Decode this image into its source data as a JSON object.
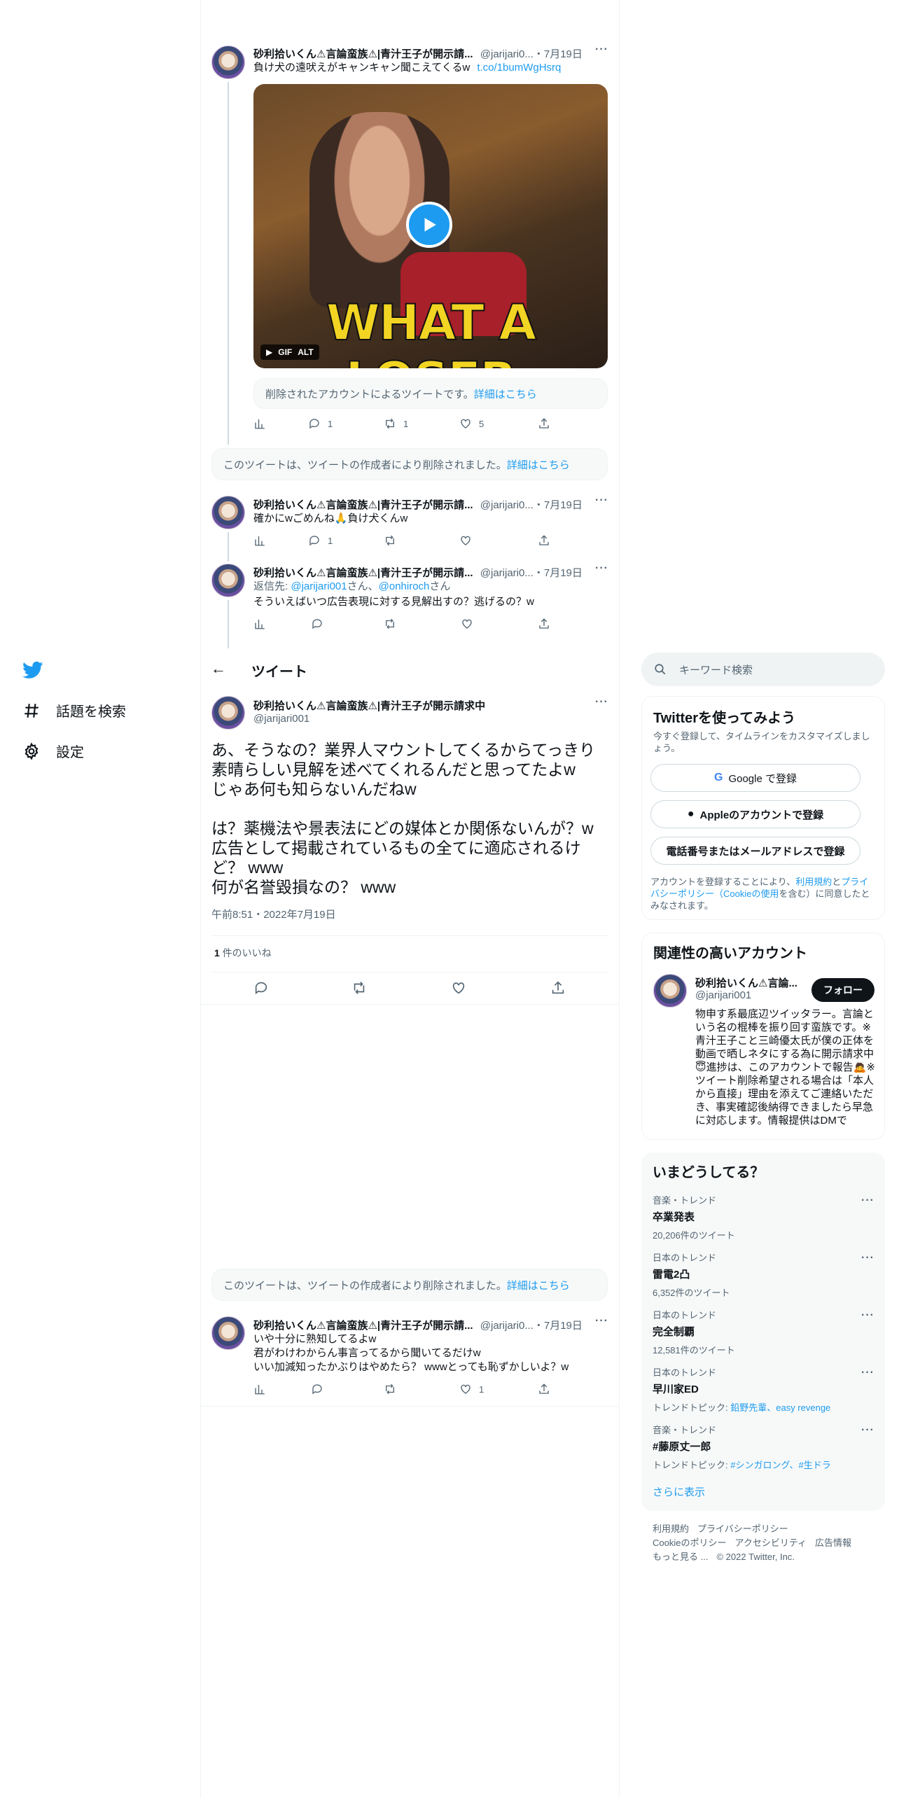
{
  "sidebar": {
    "items": [
      {
        "icon": "hashtag-icon",
        "label": "話題を検索"
      },
      {
        "icon": "gear-icon",
        "label": "設定"
      }
    ]
  },
  "thread_above": [
    {
      "name": "砂利拾いくん⚠言論蛮族⚠|青汁王子が開示請...",
      "handle": "@jarijari0...",
      "date": "・7月19日",
      "text": "負け犬の遠吠えがキャンキャン聞こえてくるw",
      "link": "t.co/1bumWgHsrq",
      "gif_caption": "WHAT A LOSER",
      "gif_badge": "GIF",
      "alt_badge": "ALT",
      "deleted_account_notice": "削除されたアカウントによるツイートです。",
      "deleted_account_link": "詳細はこちら",
      "replies": "1",
      "retweets": "1",
      "likes": "5"
    }
  ],
  "deleted_notice_1": {
    "text": "このツイートは、ツイートの作成者により削除されました。",
    "link": "詳細はこちら"
  },
  "thread_mid": [
    {
      "name": "砂利拾いくん⚠言論蛮族⚠|青汁王子が開示請...",
      "handle": "@jarijari0...",
      "date": "・7月19日",
      "text": "確かにwごめんね🙏負け犬くんw",
      "replies": "1",
      "retweets": "",
      "likes": ""
    },
    {
      "name": "砂利拾いくん⚠言論蛮族⚠|青汁王子が開示請...",
      "handle": "@jarijari0...",
      "date": "・7月19日",
      "reply_to_label": "返信先: ",
      "reply_to_1": "@jarijari001",
      "reply_to_mid": "さん、",
      "reply_to_2": "@onhiroch",
      "reply_to_end": "さん",
      "text": "そういえばいつ広告表現に対する見解出すの？逃げるの？w",
      "replies": "",
      "retweets": "",
      "likes": ""
    }
  ],
  "header": {
    "title": "ツイート"
  },
  "main_tweet": {
    "name": "砂利拾いくん⚠言論蛮族⚠|青汁王子が開示請求中",
    "handle": "@jarijari001",
    "text": "あ、そうなの？業界人マウントしてくるからてっきり素晴らしい見解を述べてくれるんだと思ってたよw\nじゃあ何も知らないんだねw\n\nは？薬機法や景表法にどの媒体とか関係ないんが？w\n広告として掲載されているもの全てに適応されるけど？ www\n何が名誉毀損なの？ www",
    "timestamp": "午前8:51・2022年7月19日",
    "likes_count": "1",
    "likes_label": " 件のいいね"
  },
  "deleted_notice_2": {
    "text": "このツイートは、ツイートの作成者により削除されました。",
    "link": "詳細はこちら"
  },
  "reply_tweet": {
    "name": "砂利拾いくん⚠言論蛮族⚠|青汁王子が開示請...",
    "handle": "@jarijari0...",
    "date": "・7月19日",
    "text": "いや十分に熟知してるよw\n君がわけわからん事言ってるから聞いてるだけw\nいい加減知ったかぶりはやめたら？ wwwとっても恥ずかしいよ？w",
    "replies": "",
    "retweets": "",
    "likes": "1"
  },
  "search": {
    "placeholder": "キーワード検索"
  },
  "signup": {
    "title": "Twitterを使ってみよう",
    "subtitle": "今すぐ登録して、タイムラインをカスタマイズしましょう。",
    "google_btn": "Google で登録",
    "apple_btn": "Appleのアカウントで登録",
    "phone_btn": "電話番号またはメールアドレスで登録",
    "terms_1": "アカウントを登録することにより、",
    "terms_link_1": "利用規約",
    "terms_2": "と",
    "terms_link_2": "プライバシーポリシー（Cookieの使用",
    "terms_3": "を含む）に同意したとみなされます。"
  },
  "related": {
    "title": "関連性の高いアカウント",
    "name": "砂利拾いくん⚠言論...",
    "handle": "@jarijari001",
    "follow_btn": "フォロー",
    "bio": "物申す系最底辺ツイッタラー。言論という名の棍棒を振り回す蛮族です。※青汁王子こと三崎優太氏が僕の正体を動画で晒しネタにする為に開示請求中😇進捗は、このアカウントで報告🙇※ツイート削除希望される場合は「本人から直接」理由を添えてご連絡いただき、事実確認後納得できましたら早急に対応します。情報提供はDMで"
  },
  "trends": {
    "title": "いまどうしてる？",
    "items": [
      {
        "category": "音楽・トレンド",
        "name": "卒業発表",
        "count": "20,206件のツイート"
      },
      {
        "category": "日本のトレンド",
        "name": "雷電2凸",
        "count": "6,352件のツイート"
      },
      {
        "category": "日本のトレンド",
        "name": "完全制覇",
        "count": "12,581件のツイート"
      },
      {
        "category": "日本のトレンド",
        "name": "早川家ED",
        "topic_label": "トレンドトピック: ",
        "topic": "鉛野先輩、easy revenge"
      },
      {
        "category": "音楽・トレンド",
        "name": "#藤原丈一郎",
        "topic_label": "トレンドトピック: ",
        "topic": "#シンガロング、#生ドラ"
      }
    ],
    "show_more": "さらに表示"
  },
  "footer": {
    "line1_a": "利用規約",
    "line1_b": "プライバシーポリシー",
    "line2_a": "Cookieのポリシー",
    "line2_b": "アクセシビリティ",
    "line2_c": "広告情報",
    "line3_a": "もっと見る ...",
    "line3_b": "© 2022 Twitter, Inc."
  },
  "colors": {
    "accent": "#1d9bf0",
    "text": "#0f1419",
    "muted": "#536471",
    "border": "#eff3f4",
    "panel": "#f7f9f9"
  }
}
